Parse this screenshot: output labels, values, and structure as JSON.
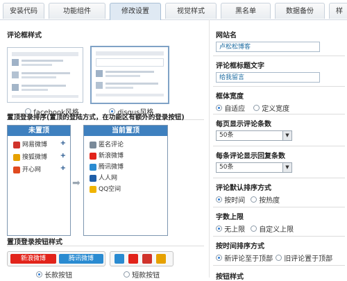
{
  "tabs": [
    {
      "label": "安装代码",
      "active": false
    },
    {
      "label": "功能组件",
      "active": false
    },
    {
      "label": "修改设置",
      "active": true
    },
    {
      "label": "视觉样式",
      "active": false
    },
    {
      "label": "黑名单",
      "active": false
    },
    {
      "label": "数据备份",
      "active": false
    },
    {
      "label": "样",
      "active": false
    }
  ],
  "comment_style": {
    "title": "评论框样式",
    "options": [
      {
        "label": "facebook风格",
        "selected": false
      },
      {
        "label": "disqus风格",
        "selected": true
      }
    ]
  },
  "login_order": {
    "title": "置顶登录排序(置顶的登陆方式，在功能区有额外的登录按钮)",
    "pinned_header": "未置顶",
    "pinned_items": [
      {
        "label": "网易微博",
        "icon": "netease-icon",
        "color": "#d0332b"
      },
      {
        "label": "搜狐微博",
        "icon": "sohu-icon",
        "color": "#e6a100"
      },
      {
        "label": "开心网",
        "icon": "kaixin-icon",
        "color": "#e04a1f"
      }
    ],
    "current_header": "当前置顶",
    "current_items": [
      {
        "label": "匿名评论",
        "icon": "anonymous-icon",
        "color": "#7a8a99"
      },
      {
        "label": "新浪微博",
        "icon": "sina-icon",
        "color": "#e2231a"
      },
      {
        "label": "腾讯微博",
        "icon": "tencent-icon",
        "color": "#2a8bd1"
      },
      {
        "label": "人人网",
        "icon": "renren-icon",
        "color": "#1f5ea8"
      },
      {
        "label": "QQ空间",
        "icon": "qzone-icon",
        "color": "#f0b400"
      }
    ],
    "plus_symbol": "+"
  },
  "button_style": {
    "title": "置顶登录按钮样式",
    "long_samples": [
      "新浪微博",
      "腾讯微博"
    ],
    "options": [
      {
        "label": "长款按钮",
        "selected": true
      },
      {
        "label": "短款按钮",
        "selected": false
      }
    ]
  },
  "settings": {
    "site_name": {
      "label": "网站名",
      "value": "卢松松博客"
    },
    "box_title": {
      "label": "评论框标题文字",
      "value": "给我留言"
    },
    "box_width": {
      "label": "框体宽度",
      "options": [
        {
          "label": "自适应",
          "selected": true
        },
        {
          "label": "定义宽度",
          "selected": false
        }
      ]
    },
    "per_page": {
      "label": "每页显示评论条数",
      "value": "50条"
    },
    "replies": {
      "label": "每条评论显示回复条数",
      "value": "50条"
    },
    "sort": {
      "label": "评论默认排序方式",
      "options": [
        {
          "label": "按时间",
          "selected": true
        },
        {
          "label": "按热度",
          "selected": false
        }
      ]
    },
    "word_limit": {
      "label": "字数上限",
      "options": [
        {
          "label": "无上限",
          "selected": true
        },
        {
          "label": "自定义上限",
          "selected": false
        }
      ]
    },
    "time_sort": {
      "label": "按时间排序方式",
      "options": [
        {
          "label": "新评论至于顶部",
          "selected": true
        },
        {
          "label": "旧评论置于顶部",
          "selected": false
        }
      ]
    },
    "next_label": "按钮样式"
  },
  "colors": {
    "accent": "#3e80bf",
    "tab_active": "#dfe9f3"
  }
}
